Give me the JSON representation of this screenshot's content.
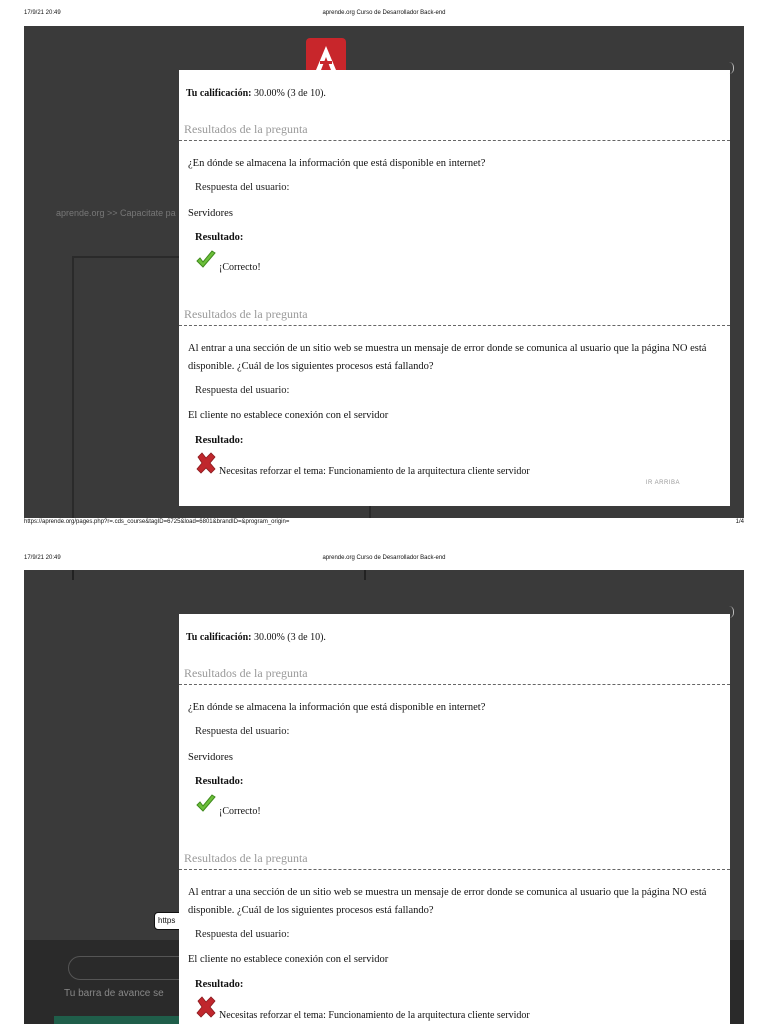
{
  "print": {
    "datetime": "17/9/21 20:49",
    "title": "aprende.org Curso de Desarrollador Back-end",
    "url": "https://aprende.org/pages.php?r=.cds_course&tagID=6725&load=6801&brandID=&program_origin=",
    "page_num": "1/4"
  },
  "background": {
    "breadcrumb": "aprende.org >> Capacitate pa",
    "https_chip": "https",
    "progress_text": "Tu barra de avance se"
  },
  "quiz": {
    "grade_label": "Tu calificación:",
    "grade_value": " 30.00% (3 de 10).",
    "section_title": "Resultados de la pregunta",
    "user_answer_label": "Respuesta del usuario:",
    "result_label": "Resultado:",
    "go_top": "IR ARRIBA",
    "questions": [
      {
        "question": "¿En dónde se almacena la información que está disponible en internet?",
        "answer": "Servidores",
        "result_text": "¡Correcto!",
        "correct": true
      },
      {
        "question": "Al entrar a una sección de un sitio web se muestra un mensaje de error donde se comunica al usuario que la página NO está disponible. ¿Cuál de los siguientes procesos está fallando?",
        "answer": "El cliente no establece conexión con el servidor",
        "result_text": "Necesitas reforzar el tema: Funcionamiento de la arquitectura cliente servidor",
        "correct": false
      }
    ]
  },
  "colors": {
    "overlay": "#3a3a3a",
    "brand_red": "#c8262b",
    "check_green": "#6cbf3a",
    "cross_red": "#c0272d"
  }
}
